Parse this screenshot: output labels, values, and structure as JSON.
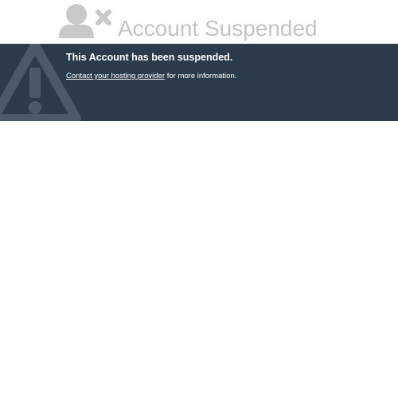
{
  "header": {
    "title": "Account Suspended",
    "icon": "user-x-icon",
    "title_color": "#c4c4c4"
  },
  "banner": {
    "background": "#2c3b4b",
    "icon": "warning-icon",
    "heading": "This Account has been suspended.",
    "contact_link": "Contact your hosting provider",
    "contact_suffix": " for more information."
  }
}
